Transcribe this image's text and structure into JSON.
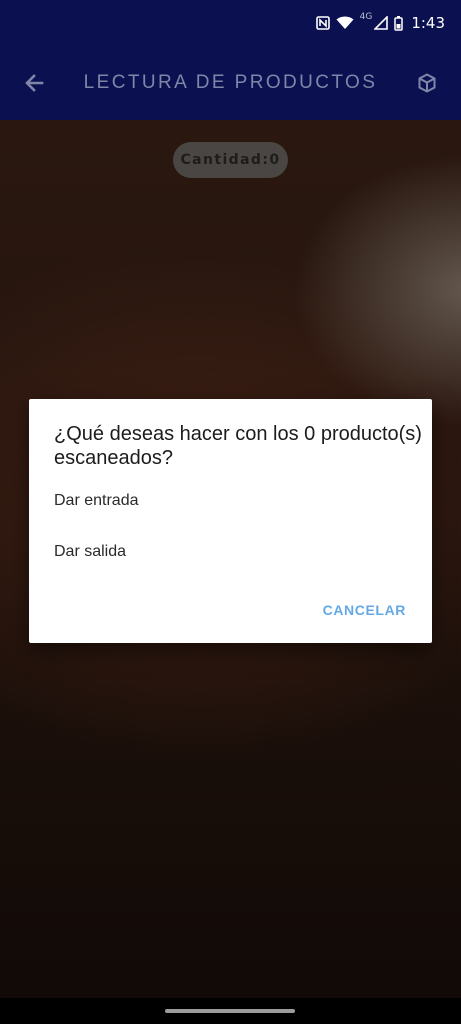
{
  "status_bar": {
    "network_label": "4G",
    "time": "1:43",
    "icons": [
      "nfc-icon",
      "wifi-icon",
      "signal-icon",
      "battery-icon"
    ]
  },
  "app_bar": {
    "title": "LECTURA DE PRODUCTOS",
    "background": "#0b1150",
    "back_icon": "arrow-back-icon",
    "action_icon": "cube-icon"
  },
  "scanner": {
    "quantity_label": "Cantidad:0"
  },
  "dialog": {
    "title": "¿Qué deseas hacer con los 0 producto(s) escaneados?",
    "options": [
      {
        "label": "Dar entrada"
      },
      {
        "label": "Dar salida"
      }
    ],
    "cancel_label": "CANCELAR",
    "accent": "#64a9e6"
  }
}
